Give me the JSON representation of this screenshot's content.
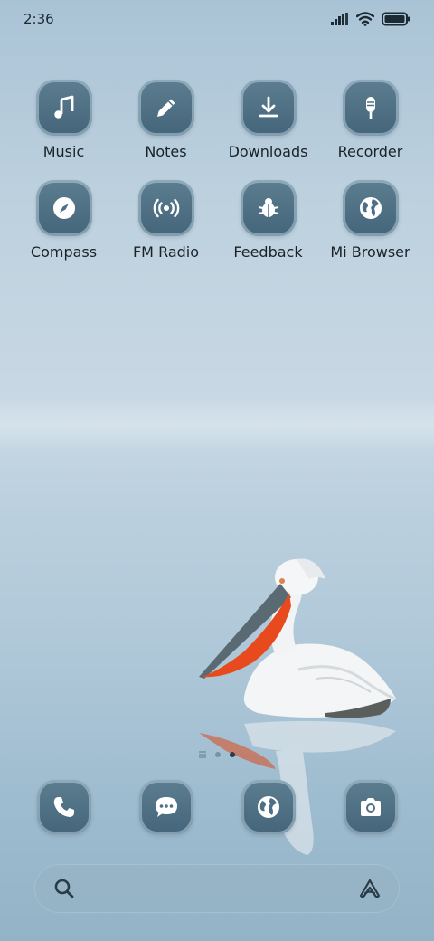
{
  "status_bar": {
    "time": "2:36"
  },
  "apps": [
    {
      "label": "Music",
      "icon": "music-note-icon"
    },
    {
      "label": "Notes",
      "icon": "pencil-icon"
    },
    {
      "label": "Downloads",
      "icon": "download-icon"
    },
    {
      "label": "Recorder",
      "icon": "microphone-icon"
    },
    {
      "label": "Compass",
      "icon": "compass-icon"
    },
    {
      "label": "FM Radio",
      "icon": "radio-icon"
    },
    {
      "label": "Feedback",
      "icon": "bug-icon"
    },
    {
      "label": "Mi Browser",
      "icon": "globe-icon"
    }
  ],
  "dock": [
    {
      "icon": "phone-icon"
    },
    {
      "icon": "message-icon"
    },
    {
      "icon": "globe-icon"
    },
    {
      "icon": "camera-icon"
    }
  ],
  "page_indicator": {
    "pages": 2,
    "active": 2
  },
  "colors": {
    "icon_bg": "#4f6f84",
    "text": "#1a2228",
    "wallpaper_sky": "#bcd0de"
  }
}
